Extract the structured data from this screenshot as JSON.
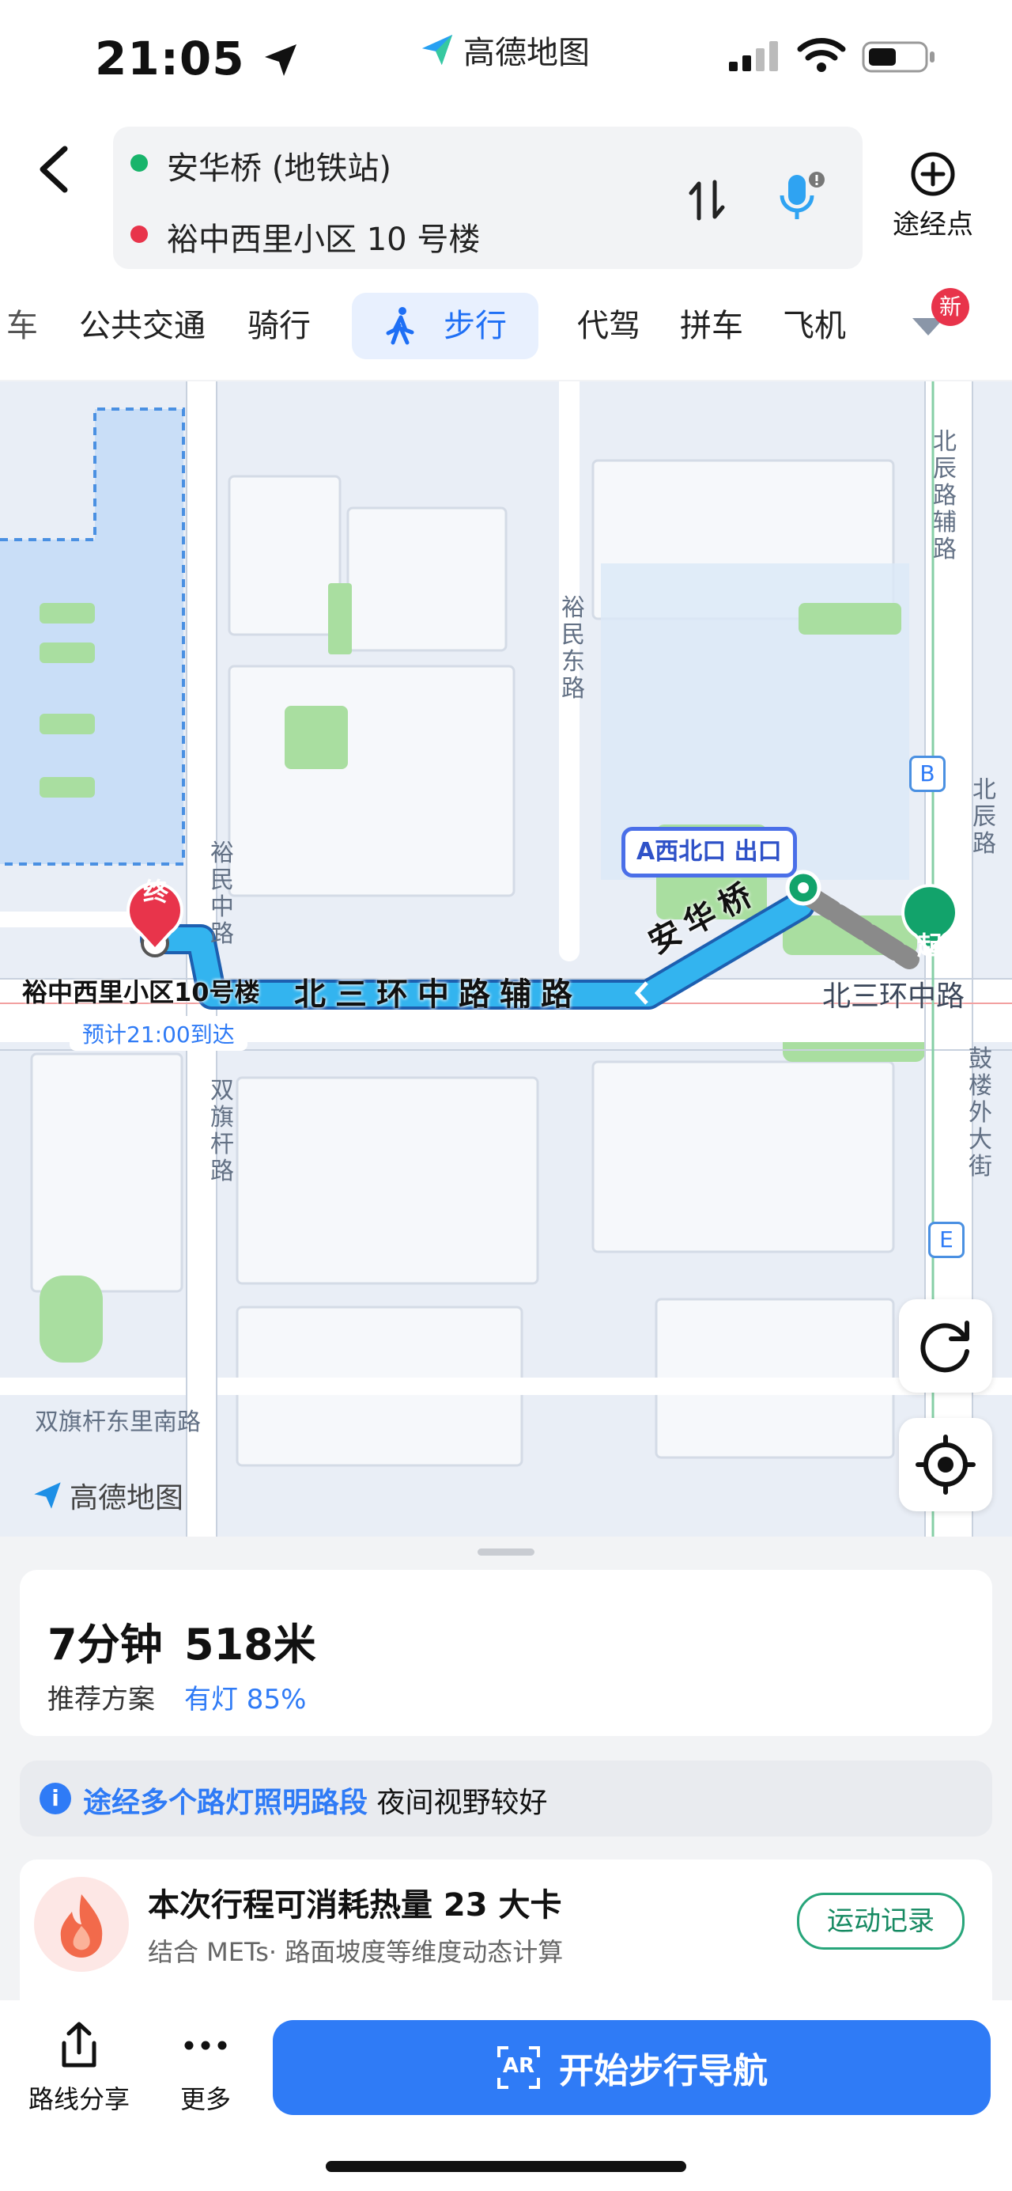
{
  "status_bar": {
    "time": "21:05",
    "brand": "高德地图"
  },
  "header": {
    "origin": "安华桥 (地铁站)",
    "destination": "裕中西里小区 10 号楼",
    "waypoint_label": "途经点"
  },
  "tabs": {
    "items": [
      "车",
      "公共交通",
      "骑行",
      "步行",
      "代驾",
      "拼车",
      "飞机"
    ],
    "active": "步行",
    "badge": "新"
  },
  "map": {
    "labels": {
      "beichen_aux": "北辰路辅路",
      "yumin_east": "裕民东路",
      "yumin_mid": "裕民中路",
      "beichen": "北辰路",
      "exit": "A西北口 出口",
      "end_pin": "终",
      "start_pin": "起",
      "destination": "裕中西里小区10号楼",
      "eta": "预计21:00到达",
      "route_road": "北三环中路辅路",
      "anhua_bridge": "安华桥",
      "north_third_ring": "北三环中路",
      "shuangqi": "双旗杆路",
      "gulou": "鼓楼外大街",
      "shuangqi_south": "双旗杆东里南路",
      "watermark": "高德地图",
      "exit_b": "B",
      "exit_e": "E"
    }
  },
  "summary": {
    "duration": "7分钟",
    "distance": "518米",
    "plan": "推荐方案",
    "lights": "有灯 85%"
  },
  "notice": {
    "highlight": "途经多个路灯照明路段",
    "text": "夜间视野较好"
  },
  "calories": {
    "title": "本次行程可消耗热量 23 大卡",
    "subtitle": "结合 METs· 路面坡度等维度动态计算",
    "button": "运动记录"
  },
  "bottom": {
    "share": "路线分享",
    "more": "更多",
    "start_nav": "开始步行导航",
    "ar": "AR"
  },
  "colors": {
    "accent": "#2f7bf6",
    "route": "#1aa7e8",
    "start": "#12a36b",
    "end": "#e8344b"
  }
}
